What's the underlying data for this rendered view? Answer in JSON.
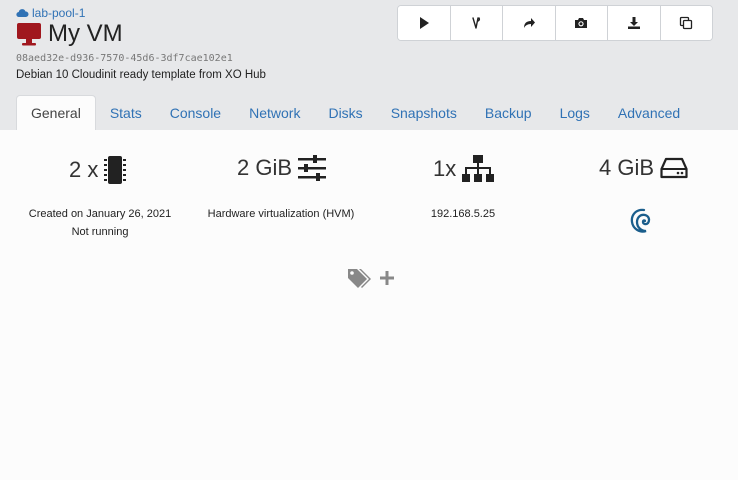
{
  "breadcrumb": {
    "pool": "lab-pool-1"
  },
  "vm": {
    "name": "My VM",
    "uuid": "08aed32e-d936-7570-45d6-3df7cae102e1",
    "description": "Debian 10 Cloudinit ready template from XO Hub",
    "status_icon_color": "#a0171e"
  },
  "toolbar": {
    "buttons": [
      "play-icon",
      "fast-clone-icon",
      "migrate-icon",
      "snapshot-icon",
      "export-icon",
      "copy-icon"
    ]
  },
  "tabs": [
    "General",
    "Stats",
    "Console",
    "Network",
    "Disks",
    "Snapshots",
    "Backup",
    "Logs",
    "Advanced"
  ],
  "active_tab": "General",
  "general": {
    "cpus": "2 x",
    "memory": "2 GiB",
    "networks": "1x",
    "disk": "4 GiB",
    "created": "Created on January 26, 2021",
    "power_state": "Not running",
    "virtualization": "Hardware virtualization (HVM)",
    "ip": "192.168.5.25",
    "os_icon": "debian-icon"
  },
  "colors": {
    "link": "#3072b5",
    "header_bg": "#e7e8ea",
    "debian": "#1b5e8c"
  }
}
